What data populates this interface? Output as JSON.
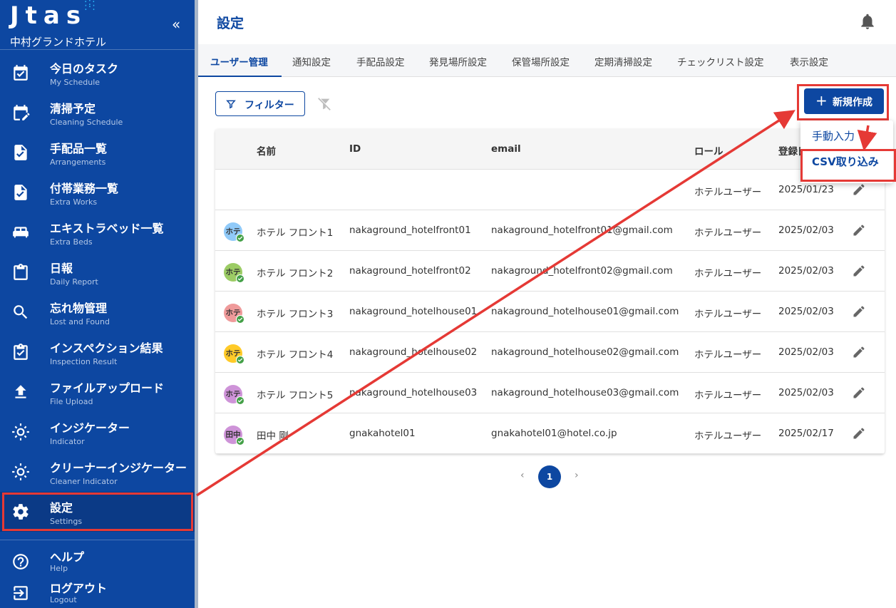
{
  "brand": {
    "logo": "Jtas",
    "hotel": "中村グランドホテル",
    "collapse": "«"
  },
  "nav": [
    {
      "jp": "今日のタスク",
      "en": "My Schedule",
      "icon": "calendar-check-icon"
    },
    {
      "jp": "清掃予定",
      "en": "Cleaning Schedule",
      "icon": "calendar-edit-icon"
    },
    {
      "jp": "手配品一覧",
      "en": "Arrangements",
      "icon": "doc-check-icon"
    },
    {
      "jp": "付帯業務一覧",
      "en": "Extra Works",
      "icon": "doc-check-icon"
    },
    {
      "jp": "エキストラベッド一覧",
      "en": "Extra Beds",
      "icon": "bed-icon"
    },
    {
      "jp": "日報",
      "en": "Daily Report",
      "icon": "clipboard-icon"
    },
    {
      "jp": "忘れ物管理",
      "en": "Lost and Found",
      "icon": "search-icon"
    },
    {
      "jp": "インスペクション結果",
      "en": "Inspection Result",
      "icon": "clipboard-check-icon"
    },
    {
      "jp": "ファイルアップロード",
      "en": "File Upload",
      "icon": "upload-icon"
    },
    {
      "jp": "インジケーター",
      "en": "Indicator",
      "icon": "sun-icon"
    },
    {
      "jp": "クリーナーインジケーター",
      "en": "Cleaner Indicator",
      "icon": "sun-icon"
    },
    {
      "jp": "設定",
      "en": "Settings",
      "icon": "gear-icon"
    }
  ],
  "nav_bottom": [
    {
      "jp": "ヘルプ",
      "en": "Help",
      "icon": "help-icon"
    },
    {
      "jp": "ログアウト",
      "en": "Logout",
      "icon": "logout-icon"
    }
  ],
  "header": {
    "title": "設定"
  },
  "tabs": [
    "ユーザー管理",
    "通知設定",
    "手配品設定",
    "発見場所設定",
    "保管場所設定",
    "定期清掃設定",
    "チェックリスト設定",
    "表示設定"
  ],
  "toolbar": {
    "filter": "フィルター",
    "new": "新規作成"
  },
  "dropdown": {
    "manual": "手動入力",
    "csv": "CSV取り込み"
  },
  "table": {
    "headers": [
      "名前",
      "ID",
      "email",
      "ロール",
      "登録日"
    ],
    "rows": [
      {
        "avatar": "",
        "avatar_color": "",
        "name": "",
        "id": "",
        "email": "",
        "role": "ホテルユーザー",
        "date": "2025/01/23"
      },
      {
        "avatar": "ホテ",
        "avatar_color": "#90caf9",
        "name": "ホテル フロント1",
        "id": "nakaground_hotelfront01",
        "email": "nakaground_hotelfront01@gmail.com",
        "role": "ホテルユーザー",
        "date": "2025/02/03"
      },
      {
        "avatar": "ホテ",
        "avatar_color": "#9ccc65",
        "name": "ホテル フロント2",
        "id": "nakaground_hotelfront02",
        "email": "nakaground_hotelfront02@gmail.com",
        "role": "ホテルユーザー",
        "date": "2025/02/03"
      },
      {
        "avatar": "ホテ",
        "avatar_color": "#ef9a9a",
        "name": "ホテル フロント3",
        "id": "nakaground_hotelhouse01",
        "email": "nakaground_hotelhouse01@gmail.com",
        "role": "ホテルユーザー",
        "date": "2025/02/03"
      },
      {
        "avatar": "ホテ",
        "avatar_color": "#ffca28",
        "name": "ホテル フロント4",
        "id": "nakaground_hotelhouse02",
        "email": "nakaground_hotelhouse02@gmail.com",
        "role": "ホテルユーザー",
        "date": "2025/02/03"
      },
      {
        "avatar": "ホテ",
        "avatar_color": "#ce93d8",
        "name": "ホテル フロント5",
        "id": "nakaground_hotelhouse03",
        "email": "nakaground_hotelhouse03@gmail.com",
        "role": "ホテルユーザー",
        "date": "2025/02/03"
      },
      {
        "avatar": "田中",
        "avatar_color": "#ce93d8",
        "name": "田中 剛",
        "id": "gnakahotel01",
        "email": "gnakahotel01@hotel.co.jp",
        "role": "ホテルユーザー",
        "date": "2025/02/17"
      }
    ]
  },
  "pagination": {
    "prev": "‹",
    "current": "1",
    "next": "›"
  },
  "colors": {
    "primary": "#0d47a1",
    "annotation": "#e53935"
  }
}
